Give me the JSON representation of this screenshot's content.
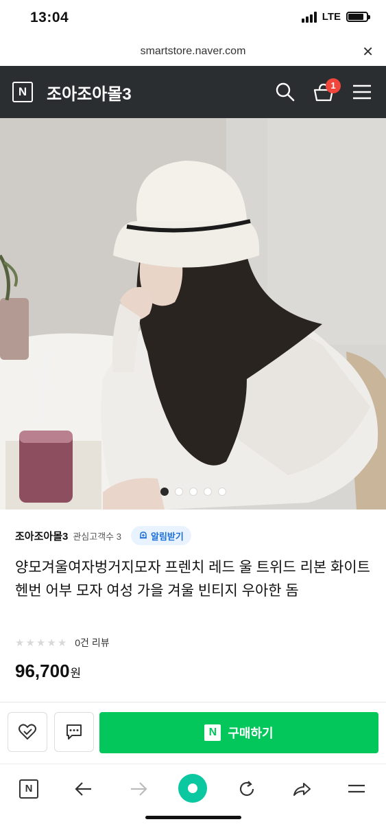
{
  "status_bar": {
    "time": "13:04",
    "network": "LTE"
  },
  "url_bar": {
    "url": "smartstore.naver.com",
    "close_glyph": "✕"
  },
  "header": {
    "logo_letter": "N",
    "store_name": "조아조아몰3",
    "cart_count": "1",
    "icons": [
      "search-icon",
      "cart-icon",
      "menu-icon"
    ]
  },
  "carousel": {
    "total": 5,
    "active_index": 0
  },
  "seller": {
    "name": "조아조아몰3",
    "fans_label": "관심고객수 3",
    "alarm_label": "알림받기"
  },
  "product": {
    "title": "양모겨울여자벙거지모자 프렌치 레드 울 트위드 리본 화이트 헨번 어부 모자 여성 가을 겨울 빈티지 우아한 돔",
    "rating": 0,
    "review_label": "0건 리뷰",
    "price": "96,700",
    "currency": "원"
  },
  "actions": {
    "buy_logo": "N",
    "buy_label": "구매하기"
  },
  "bottom_nav": {
    "logo_letter": "N",
    "items": [
      "naver-home-icon",
      "back-arrow-icon",
      "forward-arrow-icon",
      "green-dot-icon",
      "refresh-icon",
      "share-icon",
      "menu-icon"
    ]
  },
  "colors": {
    "header_bg": "#2b2e31",
    "buy_green": "#03c75a",
    "badge_red": "#f0463c",
    "alarm_blue": "#1d6fd8"
  }
}
